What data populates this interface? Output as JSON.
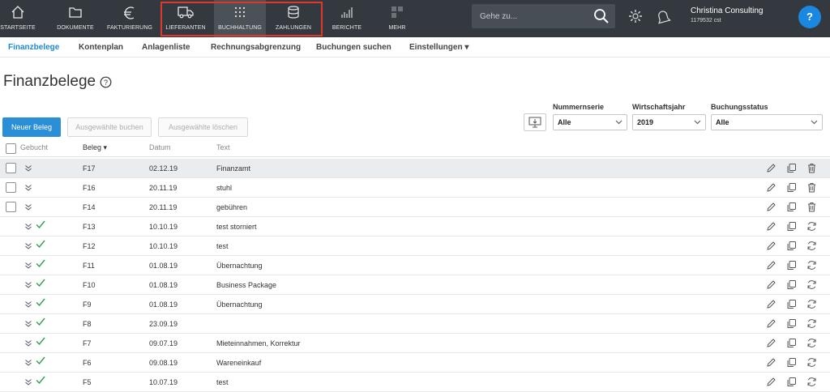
{
  "topnav": {
    "items": [
      {
        "label": "STARTSEITE",
        "icon": "home-icon"
      },
      {
        "label": "DOKUMENTE",
        "icon": "folder-icon"
      },
      {
        "label": "FAKTURIERUNG",
        "icon": "euro-icon"
      },
      {
        "label": "LIEFERANTEN",
        "icon": "truck-icon"
      },
      {
        "label": "BUCHHALTUNG",
        "icon": "grid-dots-icon"
      },
      {
        "label": "ZAHLUNGEN",
        "icon": "coins-icon"
      },
      {
        "label": "BERICHTE",
        "icon": "bar-chart-icon"
      },
      {
        "label": "MEHR",
        "icon": "apps-icon"
      }
    ],
    "search_placeholder": "Gehe zu...",
    "account_name": "Christina Consulting",
    "account_id": "1179532 cst",
    "help_label": "?",
    "highlight_color": "#e0372b"
  },
  "subnav": {
    "items": [
      "Finanzbelege",
      "Kontenplan",
      "Anlagenliste",
      "Rechnungsabgrenzung",
      "Buchungen suchen",
      "Einstellungen ▾"
    ]
  },
  "page": {
    "title": "Finanzbelege",
    "new_button": "Neuer Beleg",
    "book_button": "Ausgewählte buchen",
    "delete_button": "Ausgewählte löschen"
  },
  "filters": {
    "nummernserie": {
      "label": "Nummernserie",
      "value": "Alle"
    },
    "wirtschaftsjahr": {
      "label": "Wirtschaftsjahr",
      "value": "2019"
    },
    "buchungsstatus": {
      "label": "Buchungsstatus",
      "value": "Alle"
    }
  },
  "table": {
    "headers": {
      "gebucht": "Gebucht",
      "beleg": "Beleg ▾",
      "datum": "Datum",
      "text": "Text"
    },
    "rows": [
      {
        "beleg": "F17",
        "datum": "02.12.19",
        "text": "Finanzamt",
        "booked": false
      },
      {
        "beleg": "F16",
        "datum": "20.11.19",
        "text": "stuhl",
        "booked": false
      },
      {
        "beleg": "F14",
        "datum": "20.11.19",
        "text": "gebühren",
        "booked": false
      },
      {
        "beleg": "F13",
        "datum": "10.10.19",
        "text": "test storniert",
        "booked": true
      },
      {
        "beleg": "F12",
        "datum": "10.10.19",
        "text": "test",
        "booked": true
      },
      {
        "beleg": "F11",
        "datum": "01.08.19",
        "text": "Übernachtung",
        "booked": true
      },
      {
        "beleg": "F10",
        "datum": "01.08.19",
        "text": "Business Package",
        "booked": true
      },
      {
        "beleg": "F9",
        "datum": "01.08.19",
        "text": "Übernachtung",
        "booked": true
      },
      {
        "beleg": "F8",
        "datum": "23.09.19",
        "text": "",
        "booked": true
      },
      {
        "beleg": "F7",
        "datum": "09.07.19",
        "text": "Mieteinnahmen, Korrektur",
        "booked": true
      },
      {
        "beleg": "F6",
        "datum": "09.08.19",
        "text": "Wareneinkauf",
        "booked": true
      },
      {
        "beleg": "F5",
        "datum": "10.07.19",
        "text": "test",
        "booked": true
      }
    ]
  }
}
